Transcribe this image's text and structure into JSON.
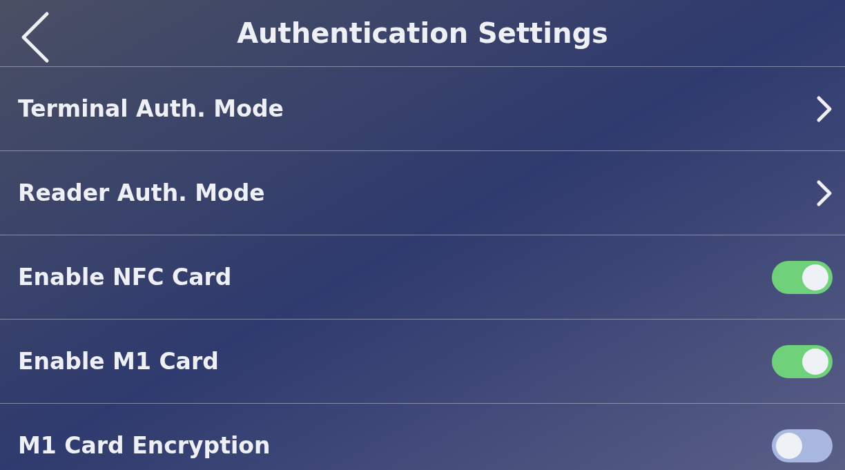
{
  "header": {
    "title": "Authentication Settings"
  },
  "items": [
    {
      "kind": "link",
      "label": "Terminal Auth. Mode"
    },
    {
      "kind": "link",
      "label": "Reader Auth. Mode"
    },
    {
      "kind": "toggle",
      "label": "Enable NFC Card",
      "on": true
    },
    {
      "kind": "toggle",
      "label": "Enable M1 Card",
      "on": true
    },
    {
      "kind": "toggle",
      "label": "M1 Card Encryption",
      "on": false
    }
  ]
}
